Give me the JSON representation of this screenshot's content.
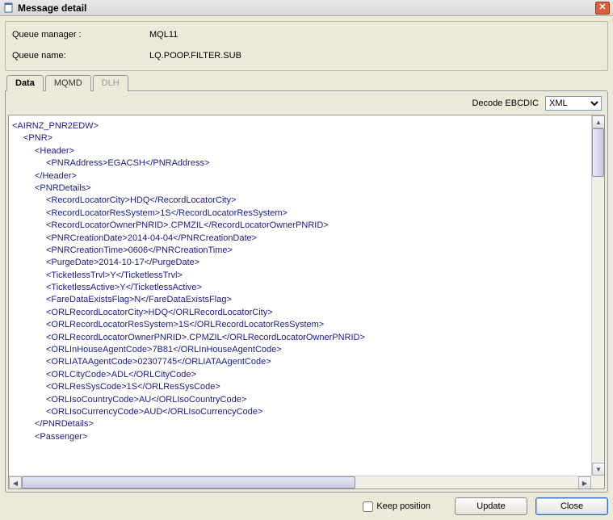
{
  "window": {
    "title": "Message detail"
  },
  "info": {
    "queue_manager_label": "Queue manager :",
    "queue_manager_value": "MQL11",
    "queue_name_label": "Queue name:",
    "queue_name_value": "LQ.POOP.FILTER.SUB"
  },
  "tabs": {
    "data": "Data",
    "mqmd": "MQMD",
    "dlh": "DLH"
  },
  "decode": {
    "label": "Decode EBCDIC",
    "selected": "XML"
  },
  "xml_lines": [
    {
      "indent": 0,
      "text": "<AIRNZ_PNR2EDW>"
    },
    {
      "indent": 1,
      "text": "<PNR>"
    },
    {
      "indent": 2,
      "text": "<Header>"
    },
    {
      "indent": 3,
      "text": "<PNRAddress>EGACSH</PNRAddress>"
    },
    {
      "indent": 2,
      "text": "</Header>"
    },
    {
      "indent": 2,
      "text": "<PNRDetails>"
    },
    {
      "indent": 3,
      "text": "<RecordLocatorCity>HDQ</RecordLocatorCity>"
    },
    {
      "indent": 3,
      "text": "<RecordLocatorResSystem>1S</RecordLocatorResSystem>"
    },
    {
      "indent": 3,
      "text": "<RecordLocatorOwnerPNRID>.CPMZIL</RecordLocatorOwnerPNRID>"
    },
    {
      "indent": 3,
      "text": "<PNRCreationDate>2014-04-04</PNRCreationDate>"
    },
    {
      "indent": 3,
      "text": "<PNRCreationTime>0606</PNRCreationTime>"
    },
    {
      "indent": 3,
      "text": "<PurgeDate>2014-10-17</PurgeDate>"
    },
    {
      "indent": 3,
      "text": "<TicketlessTrvl>Y</TicketlessTrvl>"
    },
    {
      "indent": 3,
      "text": "<TicketlessActive>Y</TicketlessActive>"
    },
    {
      "indent": 3,
      "text": "<FareDataExistsFlag>N</FareDataExistsFlag>"
    },
    {
      "indent": 3,
      "text": "<ORLRecordLocatorCity>HDQ</ORLRecordLocatorCity>"
    },
    {
      "indent": 3,
      "text": "<ORLRecordLocatorResSystem>1S</ORLRecordLocatorResSystem>"
    },
    {
      "indent": 3,
      "text": "<ORLRecordLocatorOwnerPNRID>.CPMZIL</ORLRecordLocatorOwnerPNRID>"
    },
    {
      "indent": 3,
      "text": "<ORLInHouseAgentCode>7B81</ORLInHouseAgentCode>"
    },
    {
      "indent": 3,
      "text": "<ORLIATAAgentCode>02307745</ORLIATAAgentCode>"
    },
    {
      "indent": 3,
      "text": "<ORLCityCode>ADL</ORLCityCode>"
    },
    {
      "indent": 3,
      "text": "<ORLResSysCode>1S</ORLResSysCode>"
    },
    {
      "indent": 3,
      "text": "<ORLIsoCountryCode>AU</ORLIsoCountryCode>"
    },
    {
      "indent": 3,
      "text": "<ORLIsoCurrencyCode>AUD</ORLIsoCurrencyCode>"
    },
    {
      "indent": 2,
      "text": "</PNRDetails>"
    },
    {
      "indent": 2,
      "text": "<Passenger>"
    }
  ],
  "footer": {
    "keep_position": "Keep position",
    "update": "Update",
    "close": "Close"
  }
}
